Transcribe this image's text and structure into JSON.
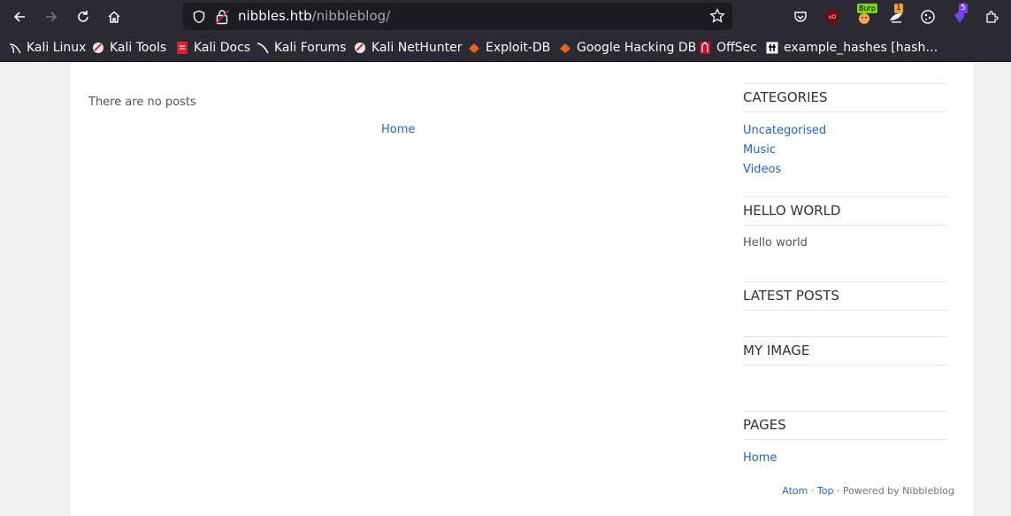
{
  "browser": {
    "url_host": "nibbles.htb",
    "url_path": "/nibbleblog/",
    "extensions": {
      "burp_badge": "Burp",
      "notify_badge": "1",
      "purple_badge": "5"
    }
  },
  "bookmarks": [
    {
      "label": "Kali Linux",
      "icon": "kali-dragon-icon"
    },
    {
      "label": "Kali Tools",
      "icon": "kali-tools-icon"
    },
    {
      "label": "Kali Docs",
      "icon": "kali-docs-icon"
    },
    {
      "label": "Kali Forums",
      "icon": "kali-forums-icon"
    },
    {
      "label": "Kali NetHunter",
      "icon": "kali-nethunter-icon"
    },
    {
      "label": "Exploit-DB",
      "icon": "exploit-db-icon"
    },
    {
      "label": "Google Hacking DB",
      "icon": "ghdb-icon"
    },
    {
      "label": "OffSec",
      "icon": "offsec-icon"
    },
    {
      "label": "example_hashes [hash…",
      "icon": "hashcat-icon"
    }
  ],
  "main": {
    "no_posts": "There are no posts",
    "home_link": "Home"
  },
  "sidebar": {
    "categories": {
      "title": "CATEGORIES",
      "items": [
        "Uncategorised",
        "Music",
        "Videos"
      ]
    },
    "hello_world": {
      "title": "HELLO WORLD",
      "text": "Hello world"
    },
    "latest_posts": {
      "title": "LATEST POSTS"
    },
    "my_image": {
      "title": "MY IMAGE"
    },
    "pages": {
      "title": "PAGES",
      "items": [
        "Home"
      ]
    }
  },
  "footer": {
    "atom": "Atom",
    "sep1": " · ",
    "top": "Top",
    "powered": " · Powered by Nibbleblog"
  }
}
